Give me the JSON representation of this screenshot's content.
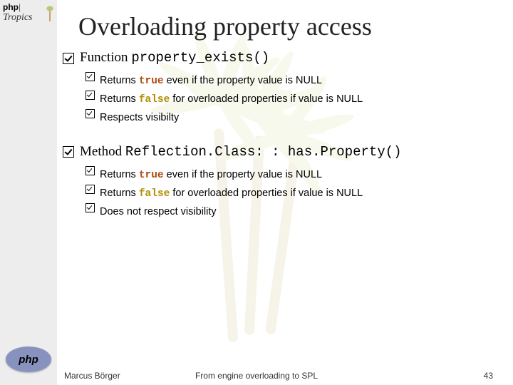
{
  "header": {
    "brand_left": "php",
    "brand_bar": "|",
    "brand_sub": "Tropics",
    "logo_text": "php"
  },
  "title": "Overloading property access",
  "sections": [
    {
      "head_prefix": "Function ",
      "head_code": "property_exists()",
      "items": [
        {
          "pre": "Returns ",
          "kw": "true",
          "kw_class": "w1",
          "post": " even if the property value is NULL"
        },
        {
          "pre": "Returns ",
          "kw": "false",
          "kw_class": "w2",
          "post": " for overloaded properties if value is NULL"
        },
        {
          "pre": "Respects visibilty",
          "kw": "",
          "kw_class": "",
          "post": ""
        }
      ]
    },
    {
      "head_prefix": "Method ",
      "head_code": "Reflection.Class: : has.Property()",
      "items": [
        {
          "pre": "Returns ",
          "kw": "true",
          "kw_class": "w1",
          "post": " even if the property value is NULL"
        },
        {
          "pre": "Returns ",
          "kw": "false",
          "kw_class": "w2",
          "post": " for overloaded properties if value is NULL"
        },
        {
          "pre": "Does not respect visibility",
          "kw": "",
          "kw_class": "",
          "post": ""
        }
      ]
    }
  ],
  "footer": {
    "author": "Marcus Börger",
    "title": "From engine overloading to SPL",
    "page": "43"
  }
}
